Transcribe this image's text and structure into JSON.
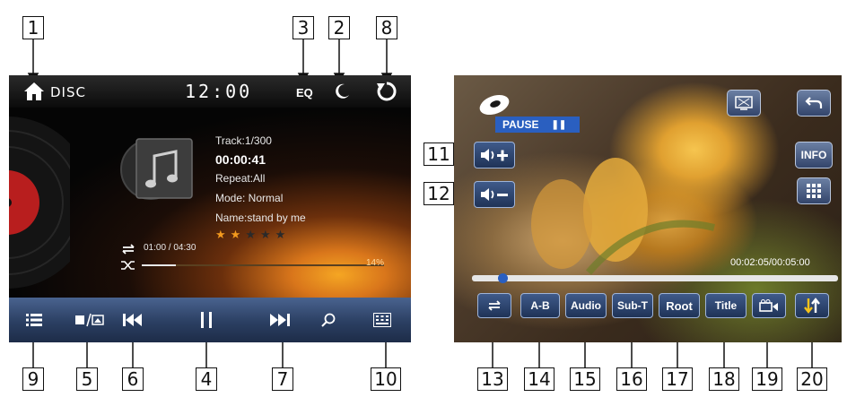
{
  "left_screen": {
    "source_label": "DISC",
    "clock": "12:00",
    "eq_label": "EQ",
    "track": "Track:1/300",
    "elapsed": "00:00:41",
    "repeat": "Repeat:All",
    "mode": "Mode: Normal",
    "name": "Name:stand by me",
    "rating_stars": 2,
    "rating_max": 5,
    "time_progress": "01:00 / 04:30",
    "percent": "14%",
    "progress_fraction": 0.14
  },
  "right_screen": {
    "status": "PAUSE",
    "time": "00:02:05/00:05:00",
    "progress_fraction": 0.07,
    "buttons": {
      "ab": "A-B",
      "audio": "Audio",
      "subt": "Sub-T",
      "root": "Root",
      "title": "Title",
      "info": "INFO"
    }
  },
  "callouts": {
    "c1": "1",
    "c2": "2",
    "c3": "3",
    "c4": "4",
    "c5": "5",
    "c6": "6",
    "c7": "7",
    "c8": "8",
    "c9": "9",
    "c10": "10",
    "c11": "11",
    "c12": "12",
    "c13": "13",
    "c14": "14",
    "c15": "15",
    "c16": "16",
    "c17": "17",
    "c18": "18",
    "c19": "19",
    "c20": "20"
  },
  "colors": {
    "star_active": "#f39a1e",
    "accent_blue": "#3a5fa5"
  }
}
